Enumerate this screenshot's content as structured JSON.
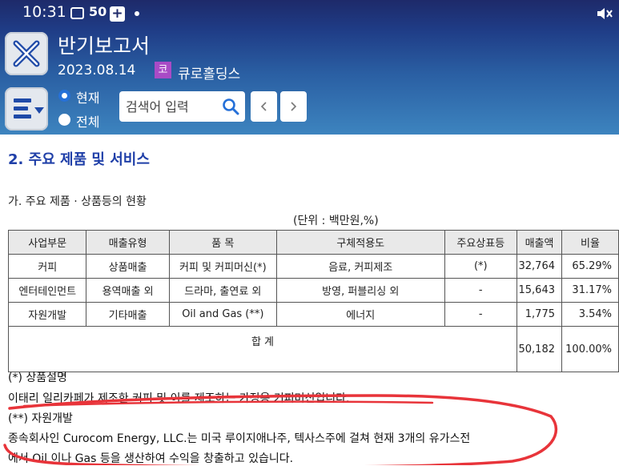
{
  "status_bar": {
    "time": "10:31",
    "badge_count": "50",
    "plus_glyph": "+"
  },
  "header": {
    "title": "반기보고서",
    "date": "2023.08.14",
    "company_badge": "코",
    "company_name": "큐로홀딩스",
    "colors": {
      "header_top": "#1e2a6a",
      "header_bottom": "#3d84bf",
      "badge": "#a94bc6",
      "accent": "#1f3fa8"
    }
  },
  "filter": {
    "option_current": "현재",
    "option_all": "전체",
    "selected": "현재"
  },
  "search": {
    "placeholder": "검색어 입력"
  },
  "icons": {
    "app": "close-x-icon",
    "menu": "list-menu-icon",
    "search": "search-icon",
    "prev": "chevron-left-icon",
    "next": "chevron-right-icon"
  },
  "content": {
    "section_title": "2. 주요 제품 및 서비스",
    "subtitle": "가. 주요 제품 · 상품등의 현황",
    "unit": "(단위 : 백만원,%)",
    "table": {
      "headers": [
        "사업부문",
        "매출유형",
        "품 목",
        "구체적용도",
        "주요상표등",
        "매출액",
        "비율"
      ],
      "rows": [
        [
          "커피",
          "상품매출",
          "커피 및 커피머신(*)",
          "음료, 커피제조",
          "(*)",
          "32,764",
          "65.29%"
        ],
        [
          "엔터테인먼트",
          "용역매출 외",
          "드라마, 출연료 외",
          "방영, 퍼블리싱 외",
          "-",
          "15,643",
          "31.17%"
        ],
        [
          "자원개발",
          "기타매출",
          "Oil and Gas (**)",
          "에너지",
          "-",
          "1,775",
          "3.54%"
        ]
      ],
      "total": {
        "label": "합 계",
        "amount": "50,182",
        "ratio": "100.00%"
      }
    },
    "notes": [
      "(*) 상품설명",
      "이태리 일리카페가 제조한 커피 및 이를 제조하는 가정용 커피머신입니다.",
      "(**) 자원개발",
      "종속회사인 Curocom Energy, LLC.는 미국 루이지애나주, 텍사스주에 걸쳐 현재  3개의 유가스전",
      "에서 Oil 이나 Gas 등을 생산하여 수익을 창출하고 있습니다."
    ]
  }
}
